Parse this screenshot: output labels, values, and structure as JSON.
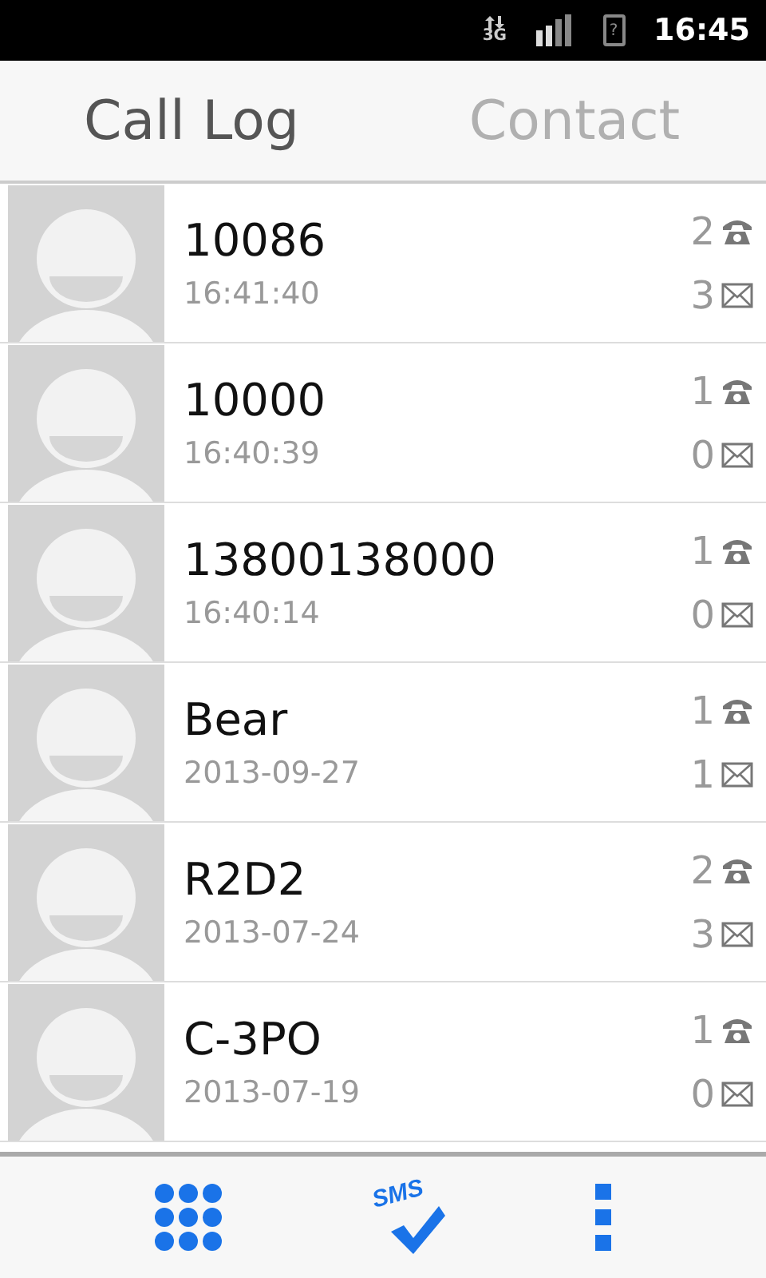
{
  "status_bar": {
    "network": "3G",
    "battery": "?",
    "time": "16:45"
  },
  "tabs": [
    {
      "label": "Call Log",
      "selected": true
    },
    {
      "label": "Contact",
      "selected": false
    }
  ],
  "entries": [
    {
      "name": "10086",
      "time": "16:41:40",
      "calls": "2",
      "messages": "3"
    },
    {
      "name": "10000",
      "time": "16:40:39",
      "calls": "1",
      "messages": "0"
    },
    {
      "name": "13800138000",
      "time": "16:40:14",
      "calls": "1",
      "messages": "0"
    },
    {
      "name": "Bear",
      "time": "2013-09-27",
      "calls": "1",
      "messages": "1"
    },
    {
      "name": "R2D2",
      "time": "2013-07-24",
      "calls": "2",
      "messages": "3"
    },
    {
      "name": "C-3PO",
      "time": "2013-07-19",
      "calls": "1",
      "messages": "0"
    }
  ],
  "bottom_bar": {
    "sms_label": "SMS"
  }
}
